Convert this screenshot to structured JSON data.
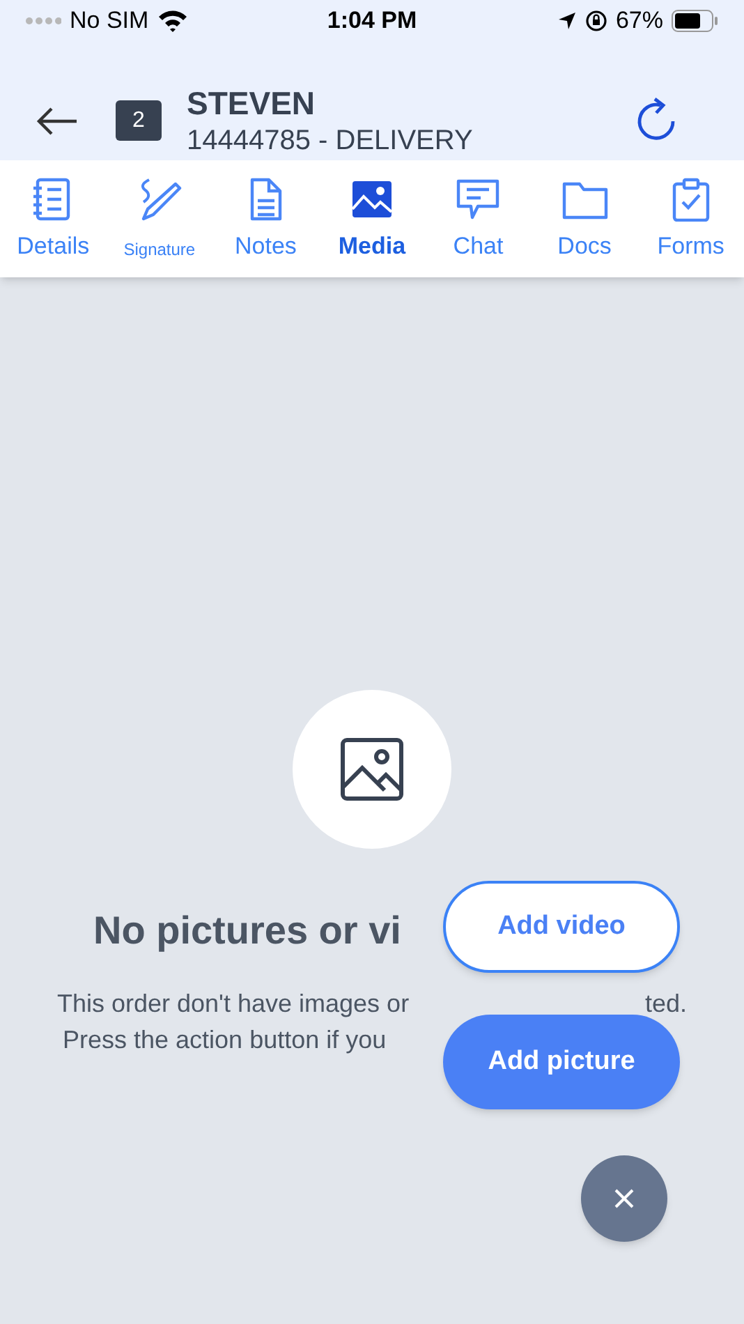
{
  "status_bar": {
    "carrier": "No SIM",
    "time": "1:04 PM",
    "battery": "67%"
  },
  "header": {
    "badge": "2",
    "title": "STEVEN",
    "subtitle": "14444785 - DELIVERY"
  },
  "tabs": [
    {
      "kind": "details",
      "label": "Details",
      "selected": false
    },
    {
      "kind": "signature",
      "label": "Signature",
      "selected": false
    },
    {
      "kind": "notes",
      "label": "Notes",
      "selected": false
    },
    {
      "kind": "media",
      "label": "Media",
      "selected": true
    },
    {
      "kind": "chat",
      "label": "Chat",
      "selected": false
    },
    {
      "kind": "docs",
      "label": "Docs",
      "selected": false
    },
    {
      "kind": "forms",
      "label": "Forms",
      "selected": false
    }
  ],
  "empty_state": {
    "heading": "No pictures or vi",
    "line_1_start": "This order don't have images or",
    "line_1_end": "ted.",
    "line_2": "Press the action button if you"
  },
  "actions": [
    "Add video",
    "Add picture"
  ]
}
